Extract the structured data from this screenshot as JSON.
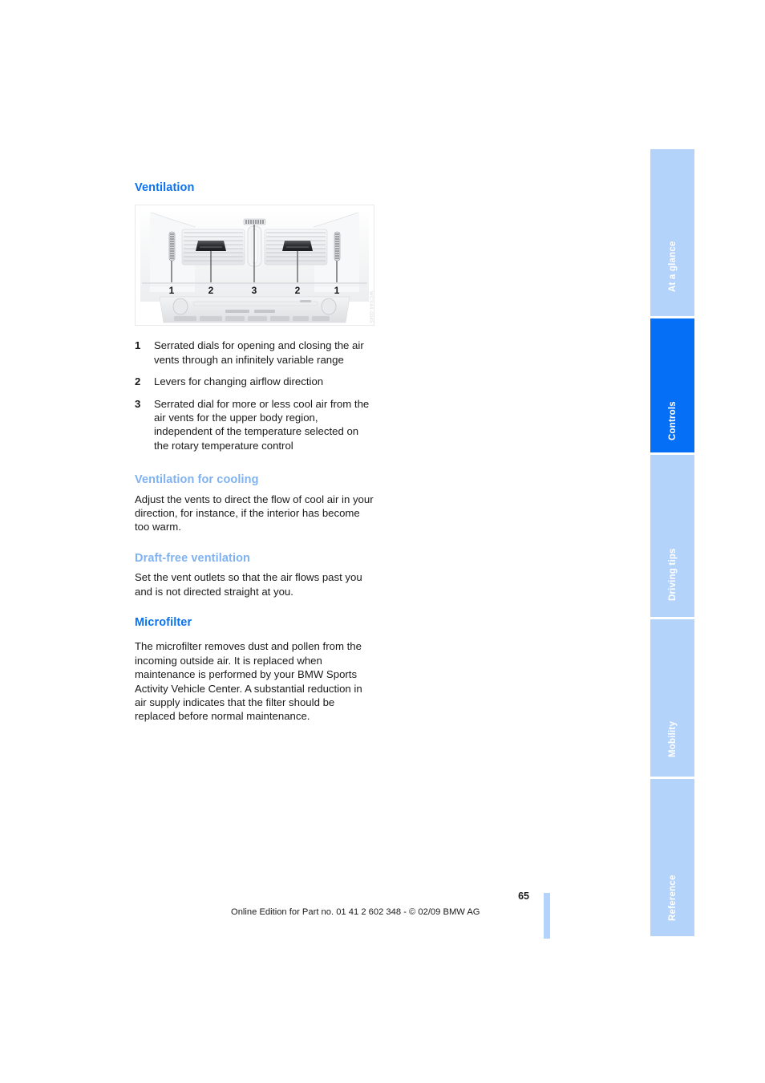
{
  "page": {
    "number": "65",
    "footer_text": "Online Edition for Part no. 01 41 2 602 348 - © 02/09 BMW AG"
  },
  "main": {
    "heading": "Ventilation",
    "figure": {
      "code": "WCS44-0045",
      "callout_labels": [
        "1",
        "2",
        "3",
        "2",
        "1"
      ],
      "alt": "Dashboard center air vents with serrated dials, levers and center vent"
    },
    "callouts": [
      {
        "key": "1",
        "text": "Serrated dials for opening and closing the air vents through an infinitely variable range"
      },
      {
        "key": "2",
        "text": "Levers for changing airflow direction"
      },
      {
        "key": "3",
        "text": "Serrated dial for more or less cool air from the air vents for the upper body region, independent of the temperature selected on the rotary temperature control"
      }
    ],
    "sections": [
      {
        "heading": "Ventilation for cooling",
        "body": "Adjust the vents to direct the flow of cool air in your direction, for instance, if the interior has become too warm."
      },
      {
        "heading": "Draft-free ventilation",
        "body": "Set the vent outlets so that the air flows past you and is not directed straight at you."
      }
    ],
    "microfilter": {
      "heading": "Microfilter",
      "body": "The microfilter removes dust and pollen from the incoming outside air. It is replaced when maintenance is performed by your BMW Sports Activity Vehicle Center. A substantial reduction in air supply indicates that the filter should be replaced before normal maintenance."
    }
  },
  "sidebar": {
    "tabs": [
      {
        "label": "At a glance",
        "active": false
      },
      {
        "label": "Controls",
        "active": true
      },
      {
        "label": "Driving tips",
        "active": false
      },
      {
        "label": "Mobility",
        "active": false
      },
      {
        "label": "Reference",
        "active": false
      }
    ]
  },
  "colors": {
    "heading_blue": "#0a72f0",
    "subheading_blue": "#7fb2f2",
    "tab_inactive": "#b4d3fb",
    "tab_active": "#0570f5",
    "text": "#1a1a1a"
  }
}
